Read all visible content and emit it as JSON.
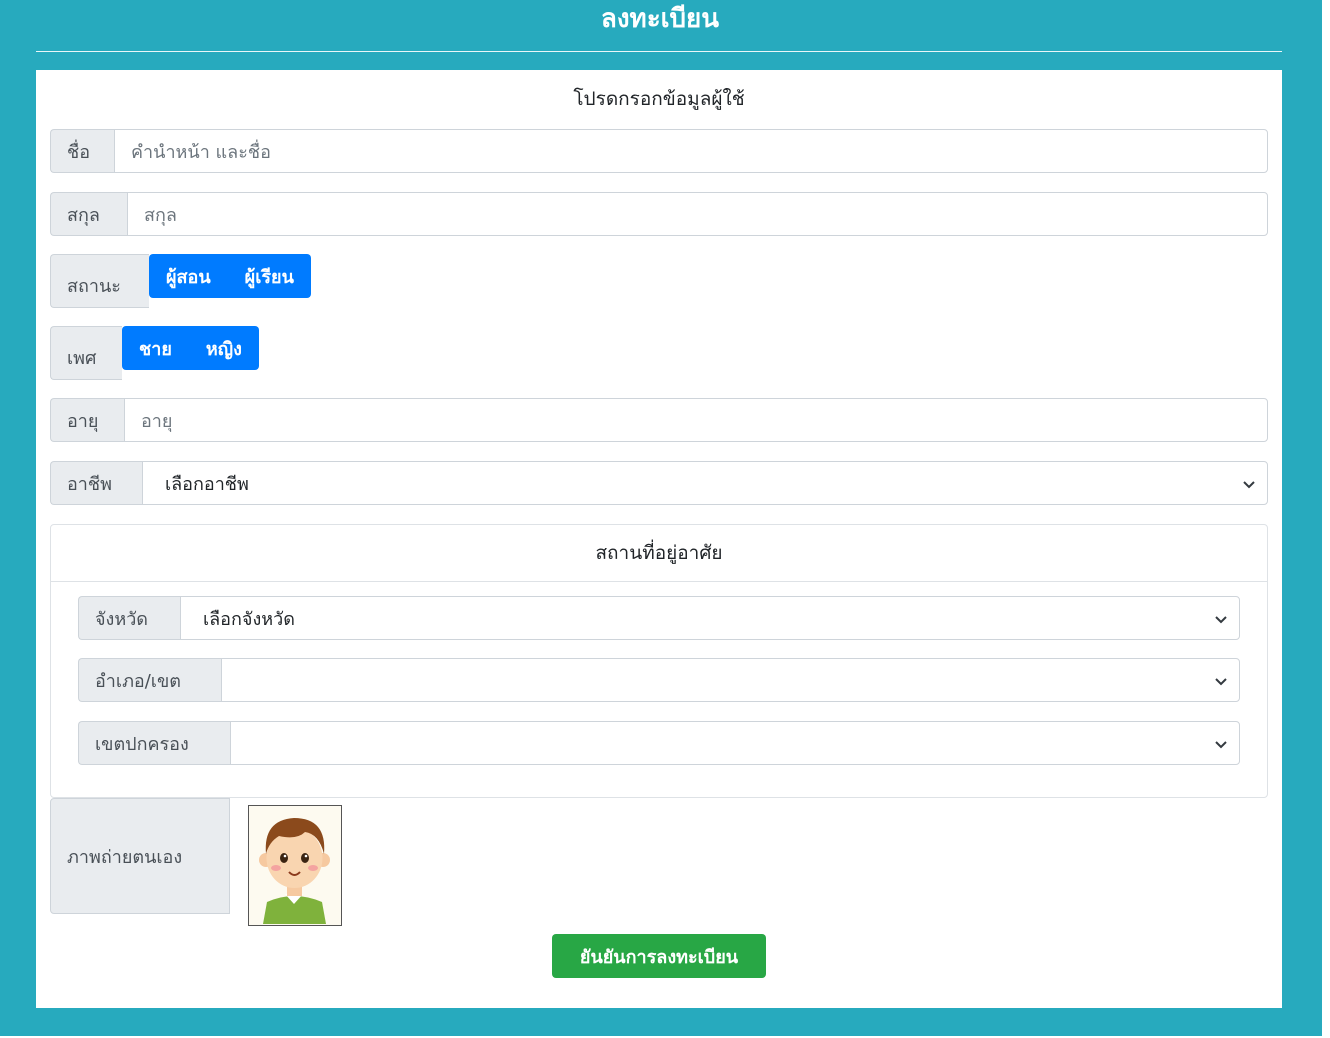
{
  "header": {
    "title": "ลงทะเบียน"
  },
  "form": {
    "heading": "โปรดกรอกข้อมูลผู้ใช้",
    "first_name": {
      "label": "ชื่อ",
      "placeholder": "คำนำหน้า และชื่อ"
    },
    "last_name": {
      "label": "สกุล",
      "placeholder": "สกุล"
    },
    "status": {
      "label": "สถานะ",
      "options": [
        "ผู้สอน",
        "ผู้เรียน"
      ]
    },
    "gender": {
      "label": "เพศ",
      "options": [
        "ชาย",
        "หญิง"
      ]
    },
    "age": {
      "label": "อายุ",
      "placeholder": "อายุ"
    },
    "occupation": {
      "label": "อาชีพ",
      "selected": "เลือกอาชีพ"
    },
    "address": {
      "heading": "สถานที่อยู่อาศัย",
      "province": {
        "label": "จังหวัด",
        "selected": "เลือกจังหวัด"
      },
      "district": {
        "label": "อำเภอ/เขต",
        "selected": ""
      },
      "subdistrict": {
        "label": "เขตปกครอง",
        "selected": ""
      }
    },
    "photo": {
      "label": "ภาพถ่ายตนเอง"
    },
    "submit_label": "ยันยันการลงทะเบียน"
  },
  "colors": {
    "background": "#27aabe",
    "primary": "#007bff",
    "success": "#28a745",
    "label_bg": "#e9ecef"
  }
}
